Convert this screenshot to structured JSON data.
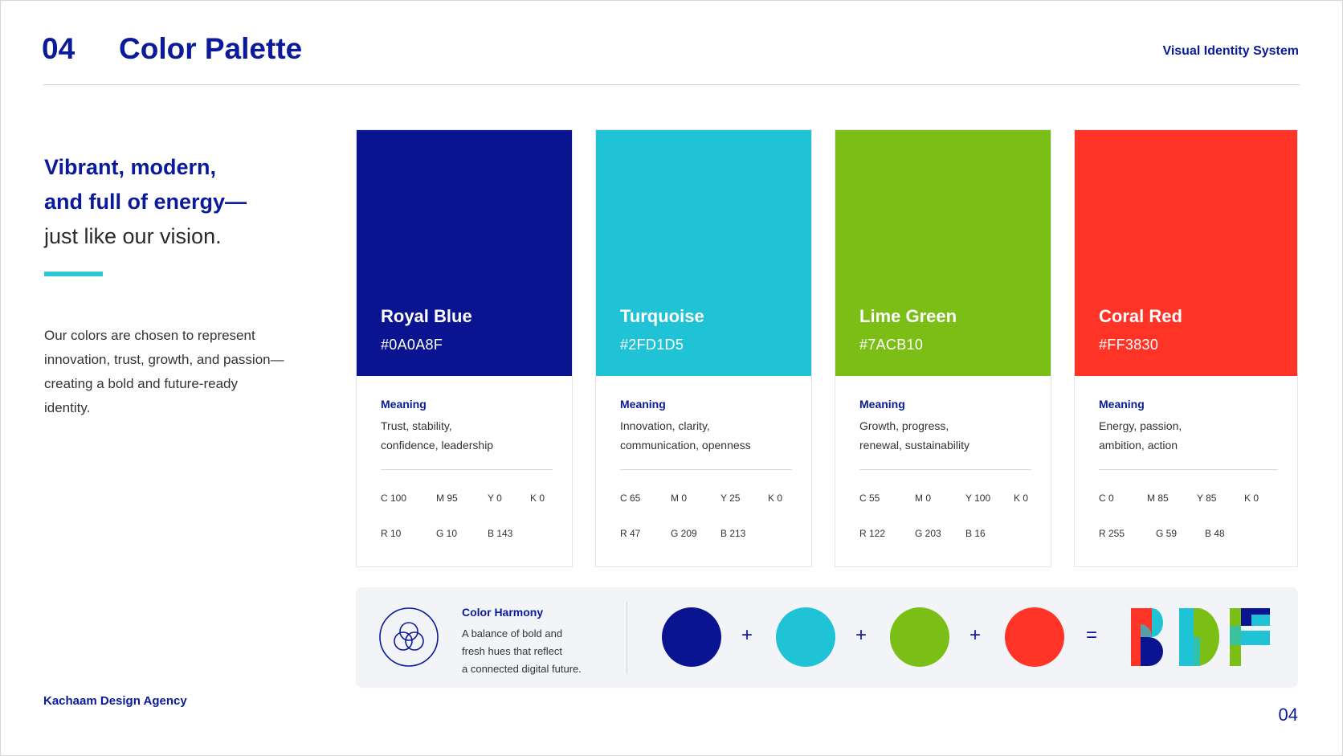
{
  "header": {
    "section_number": "04",
    "section_title": "Color Palette",
    "top_right": "Visual Identity System"
  },
  "left": {
    "tagline_line1": "Vibrant, modern,",
    "tagline_line2": "and full of energy—",
    "tagline_line3": "just like our vision.",
    "intro": "Our colors are chosen to represent innovation, trust, growth, and passion—creating a bold and future-ready identity."
  },
  "cards": [
    {
      "name": "Royal Blue",
      "hex": "#0A0A8F",
      "color": "#0A1390",
      "meaning_label": "Meaning",
      "meaning_line1": "Trust, stability,",
      "meaning_line2": "confidence, leadership",
      "cmyk": [
        "C 100",
        "M 95",
        "Y 0",
        "K 0"
      ],
      "rgb": [
        "R 10",
        "G 10",
        "B 143"
      ]
    },
    {
      "name": "Turquoise",
      "hex": "#2FD1D5",
      "color": "#1FC3D5",
      "meaning_label": "Meaning",
      "meaning_line1": "Innovation, clarity,",
      "meaning_line2": "communication, openness",
      "cmyk": [
        "C 65",
        "M 0",
        "Y 25",
        "K 0"
      ],
      "rgb": [
        "R 47",
        "G 209",
        "B 213"
      ]
    },
    {
      "name": "Lime Green",
      "hex": "#7ACB10",
      "color": "#7BBE16",
      "meaning_label": "Meaning",
      "meaning_line1": "Growth, progress,",
      "meaning_line2": "renewal, sustainability",
      "cmyk": [
        "C 55",
        "M 0",
        "Y 100",
        "K 0"
      ],
      "rgb": [
        "R 122",
        "G 203",
        "B 16"
      ]
    },
    {
      "name": "Coral Red",
      "hex": "#FF3830",
      "color": "#FF3326",
      "meaning_label": "Meaning",
      "meaning_line1": "Energy, passion,",
      "meaning_line2": "ambition, action",
      "cmyk": [
        "C 0",
        "M 85",
        "Y 85",
        "K 0"
      ],
      "rgb": [
        "R 255",
        "G 59",
        "B 48"
      ]
    }
  ],
  "harmony": {
    "title": "Color Harmony",
    "line1": "A balance of bold and",
    "line2": "fresh hues that reflect",
    "line3": "a connected digital future.",
    "plus": "+",
    "equals": "="
  },
  "footer": {
    "agency": "Kachaam Design Agency",
    "page_number": "04"
  },
  "colors": {
    "brand_navy": "#0A1A9A",
    "accent_turquoise": "#2FC7D5"
  }
}
